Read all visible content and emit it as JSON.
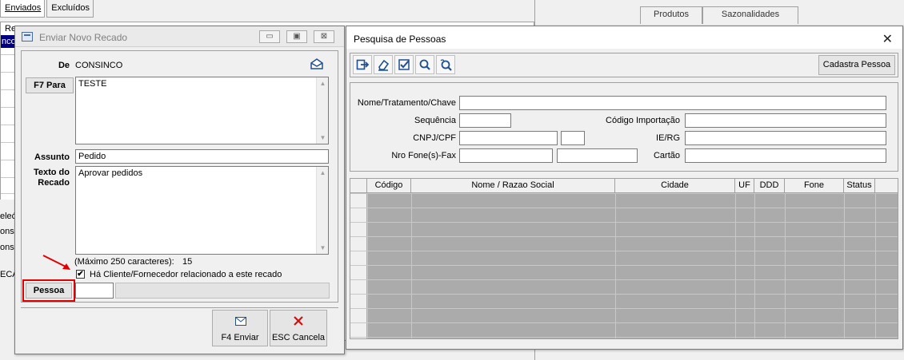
{
  "background": {
    "tabs": [
      "Enviados",
      "Excluídos"
    ],
    "right_tabs": [
      "Produtos",
      "Sazonalidades"
    ],
    "left_fragments": [
      "eleć",
      "onsir",
      "onsir",
      "ECA"
    ],
    "grid_header_fragment": "Re",
    "selected_fragment": "nco"
  },
  "recado": {
    "title": "Enviar Novo Recado",
    "win_minimize": "▭",
    "win_restore": "▣",
    "win_close": "⊠",
    "de_label": "De",
    "de_value": "CONSINCO",
    "para_label": "F7  Para",
    "para_value": "TESTE",
    "assunto_label": "Assunto",
    "assunto_value": "Pedido",
    "texto_label_1": "Texto do",
    "texto_label_2": "Recado",
    "texto_value": "Aprovar pedidos",
    "max_chars_text": "(Máximo 250 caracteres):",
    "char_count": "15",
    "checkbox_label": "Há Cliente/Fornecedor relacionado a este recado",
    "checkbox_mark": "✔",
    "pessoa_button": "Pessoa",
    "enviar_button": "F4  Enviar",
    "cancelar_button": "ESC Cancela"
  },
  "pessoas": {
    "title": "Pesquisa de Pessoas",
    "close": "✕",
    "cadastra_button": "Cadastra Pessoa",
    "toolbar_icons": [
      "exit-icon",
      "eraser-icon",
      "check-icon",
      "search-icon",
      "search-advanced-icon"
    ],
    "labels": {
      "nome": "Nome/Tratamento/Chave",
      "sequencia": "Sequência",
      "codigo_importacao": "Código Importação",
      "cnpj": "CNPJ/CPF",
      "ie": "IE/RG",
      "fone": "Nro Fone(s)-Fax",
      "cartao": "Cartão"
    },
    "columns": [
      "Código",
      "Nome / Razao Social",
      "Cidade",
      "UF",
      "DDD",
      "Fone",
      "Status"
    ]
  }
}
